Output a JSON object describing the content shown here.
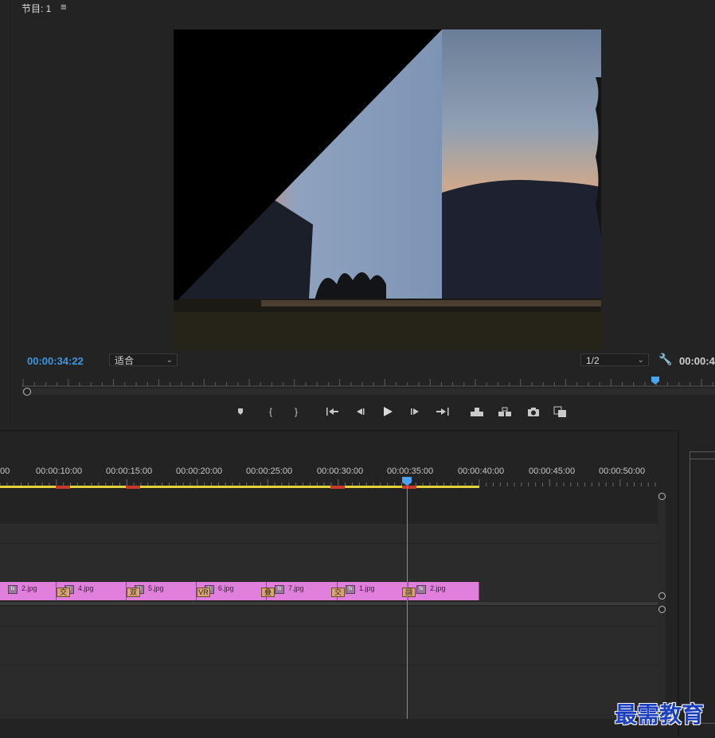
{
  "monitor": {
    "tab_title": "节目: 1",
    "tab_menu_icon": "hamburger-menu-icon",
    "timecode_current": "00:00:34:22",
    "fit_select": "适合",
    "resolution_select": "1/2",
    "timecode_duration": "00:00:4",
    "transport_icons": [
      "add-marker-icon",
      "mark-in-icon",
      "mark-out-icon",
      "go-to-in-icon",
      "step-back-icon",
      "play-icon",
      "step-forward-icon",
      "go-to-out-icon",
      "lift-icon",
      "extract-icon",
      "export-frame-icon",
      "comparison-view-icon"
    ]
  },
  "timeline": {
    "ruler_labels": [
      "00",
      "00:00:10:00",
      "00:00:15:00",
      "00:00:20:00",
      "00:00:25:00",
      "00:00:30:00",
      "00:00:35:00",
      "00:00:40:00",
      "00:00:45:00",
      "00:00:50:00"
    ],
    "clips": [
      {
        "name": "2.jpg"
      },
      {
        "name": "4.jpg"
      },
      {
        "name": "5.jpg"
      },
      {
        "name": "6.jpg"
      },
      {
        "name": "7.jpg"
      },
      {
        "name": "1.jpg"
      },
      {
        "name": "2.jpg"
      }
    ],
    "transitions": [
      "交",
      "双",
      "VR",
      "叠",
      "交",
      "翻"
    ],
    "fx_label": "fx"
  },
  "watermark": "最需教育",
  "colors": {
    "accent_blue": "#3d96e0",
    "clip_pink": "#e07fdc",
    "work_area_yellow": "#e0d33a",
    "transition_tan": "#d7a576"
  }
}
